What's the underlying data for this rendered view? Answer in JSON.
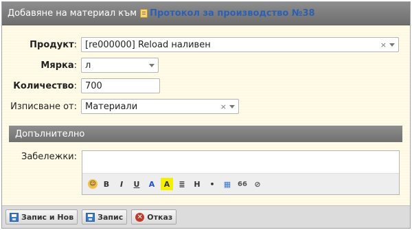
{
  "title": {
    "prefix": "Добавяне на материал към",
    "link": "Протокол за производство №38"
  },
  "form": {
    "product": {
      "label": "Продукт",
      "value": "[re000000] Reload наливен"
    },
    "unit": {
      "label": "Мярка",
      "value": "л"
    },
    "quantity": {
      "label": "Количество",
      "value": "700"
    },
    "writeoff": {
      "label": "Изписване от:",
      "value": "Материали"
    }
  },
  "section": {
    "title": "Допълнително"
  },
  "notes": {
    "label": "Забележки:",
    "value": ""
  },
  "toolbar": {
    "items": [
      {
        "name": "emoji-icon",
        "glyph": "😊"
      },
      {
        "name": "bold-button",
        "glyph": "B"
      },
      {
        "name": "italic-button",
        "glyph": "I"
      },
      {
        "name": "underline-button",
        "glyph": "U"
      },
      {
        "name": "text-color-button",
        "glyph": "A"
      },
      {
        "name": "highlight-button",
        "glyph": "A"
      },
      {
        "name": "align-icon",
        "glyph": "≣"
      },
      {
        "name": "heading-button",
        "glyph": "H"
      },
      {
        "name": "bullet-button",
        "glyph": "•"
      },
      {
        "name": "table-icon",
        "glyph": "▦"
      },
      {
        "name": "quote-icon",
        "glyph": "66"
      },
      {
        "name": "attach-icon",
        "glyph": "⊘"
      }
    ]
  },
  "footer": {
    "save_new": "Запис и Нов",
    "save": "Запис",
    "cancel": "Отказ"
  },
  "colors": {
    "link": "#2d5fb3",
    "titlebar": "#777777",
    "panel": "#fffbe6"
  }
}
